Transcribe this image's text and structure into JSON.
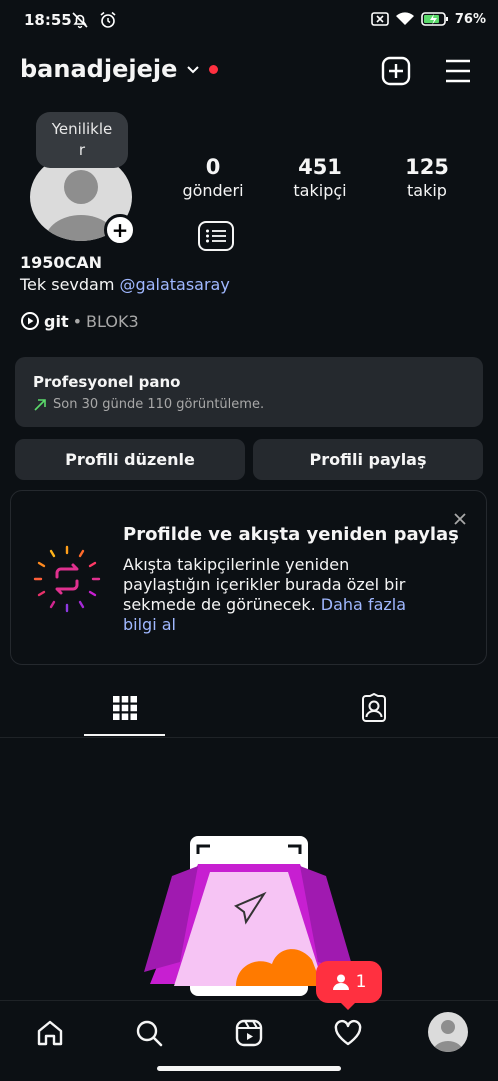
{
  "status_bar": {
    "time": "18:55",
    "battery": "76%"
  },
  "header": {
    "username": "banadjejeje"
  },
  "profile": {
    "bubble_line1": "Yenilikle",
    "bubble_line2": "r",
    "stats": [
      {
        "number": "0",
        "label": "gönderi"
      },
      {
        "number": "451",
        "label": "takipçi"
      },
      {
        "number": "125",
        "label": "takip"
      }
    ],
    "display_name": "1950CAN",
    "bio_prefix": "Tek sevdam ",
    "bio_link": "@galatasaray",
    "music_title": "git",
    "music_separator": " • ",
    "music_artist": "BLOK3"
  },
  "pro_dashboard": {
    "title": "Profesyonel pano",
    "subtitle": "Son 30 günde 110 görüntüleme."
  },
  "buttons": {
    "edit": "Profili düzenle",
    "share": "Profili paylaş"
  },
  "promo": {
    "title": "Profilde ve akışta yeniden paylaş",
    "body": "Akışta takipçilerinle yeniden paylaştığın içerikler burada özel bir sekmede de görünecek. ",
    "link": "Daha fazla bilgi al"
  },
  "notification": {
    "count": "1"
  },
  "colors": {
    "background": "#0c1014",
    "card": "#25292e",
    "accent_link": "#a0b8ff",
    "red": "#ff3040",
    "magenta": "#c71fd1",
    "orange": "#ff7a00"
  }
}
